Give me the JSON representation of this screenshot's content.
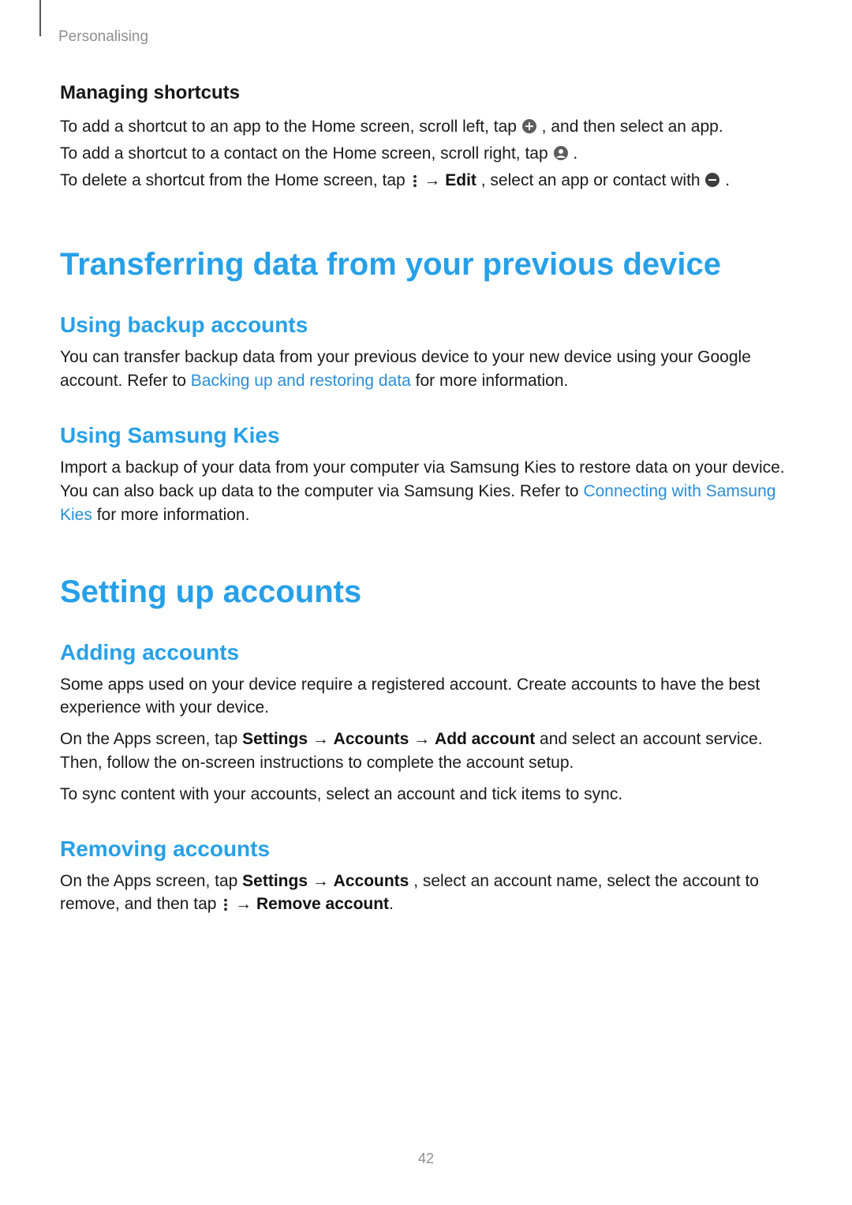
{
  "breadcrumb": "Personalising",
  "managing_shortcuts": {
    "heading": "Managing shortcuts",
    "p1_a": "To add a shortcut to an app to the Home screen, scroll left, tap ",
    "p1_b": ", and then select an app.",
    "p2_a": "To add a shortcut to a contact on the Home screen, scroll right, tap ",
    "p2_b": ".",
    "p3_a": "To delete a shortcut from the Home screen, tap ",
    "p3_arrow": " → ",
    "p3_edit": "Edit",
    "p3_b": ", select an app or contact with ",
    "p3_c": "."
  },
  "transferring": {
    "heading": "Transferring data from your previous device",
    "backup": {
      "heading": "Using backup accounts",
      "p_a": "You can transfer backup data from your previous device to your new device using your Google account. Refer to ",
      "link": "Backing up and restoring data",
      "p_b": " for more information."
    },
    "kies": {
      "heading": "Using Samsung Kies",
      "p_a": "Import a backup of your data from your computer via Samsung Kies to restore data on your device. You can also back up data to the computer via Samsung Kies. Refer to ",
      "link": "Connecting with Samsung Kies",
      "p_b": " for more information."
    }
  },
  "setting_up": {
    "heading": "Setting up accounts",
    "adding": {
      "heading": "Adding accounts",
      "p1": "Some apps used on your device require a registered account. Create accounts to have the best experience with your device.",
      "p2_a": "On the Apps screen, tap ",
      "p2_settings": "Settings",
      "p2_arr1": " → ",
      "p2_accounts": "Accounts",
      "p2_arr2": " → ",
      "p2_add": "Add account",
      "p2_b": " and select an account service. Then, follow the on-screen instructions to complete the account setup.",
      "p3": "To sync content with your accounts, select an account and tick items to sync."
    },
    "removing": {
      "heading": "Removing accounts",
      "p_a": "On the Apps screen, tap ",
      "p_settings": "Settings",
      "p_arr1": " → ",
      "p_accounts": "Accounts",
      "p_b": ", select an account name, select the account to remove, and then tap ",
      "p_arr2": " → ",
      "p_remove": "Remove account",
      "p_c": "."
    }
  },
  "page_number": "42"
}
